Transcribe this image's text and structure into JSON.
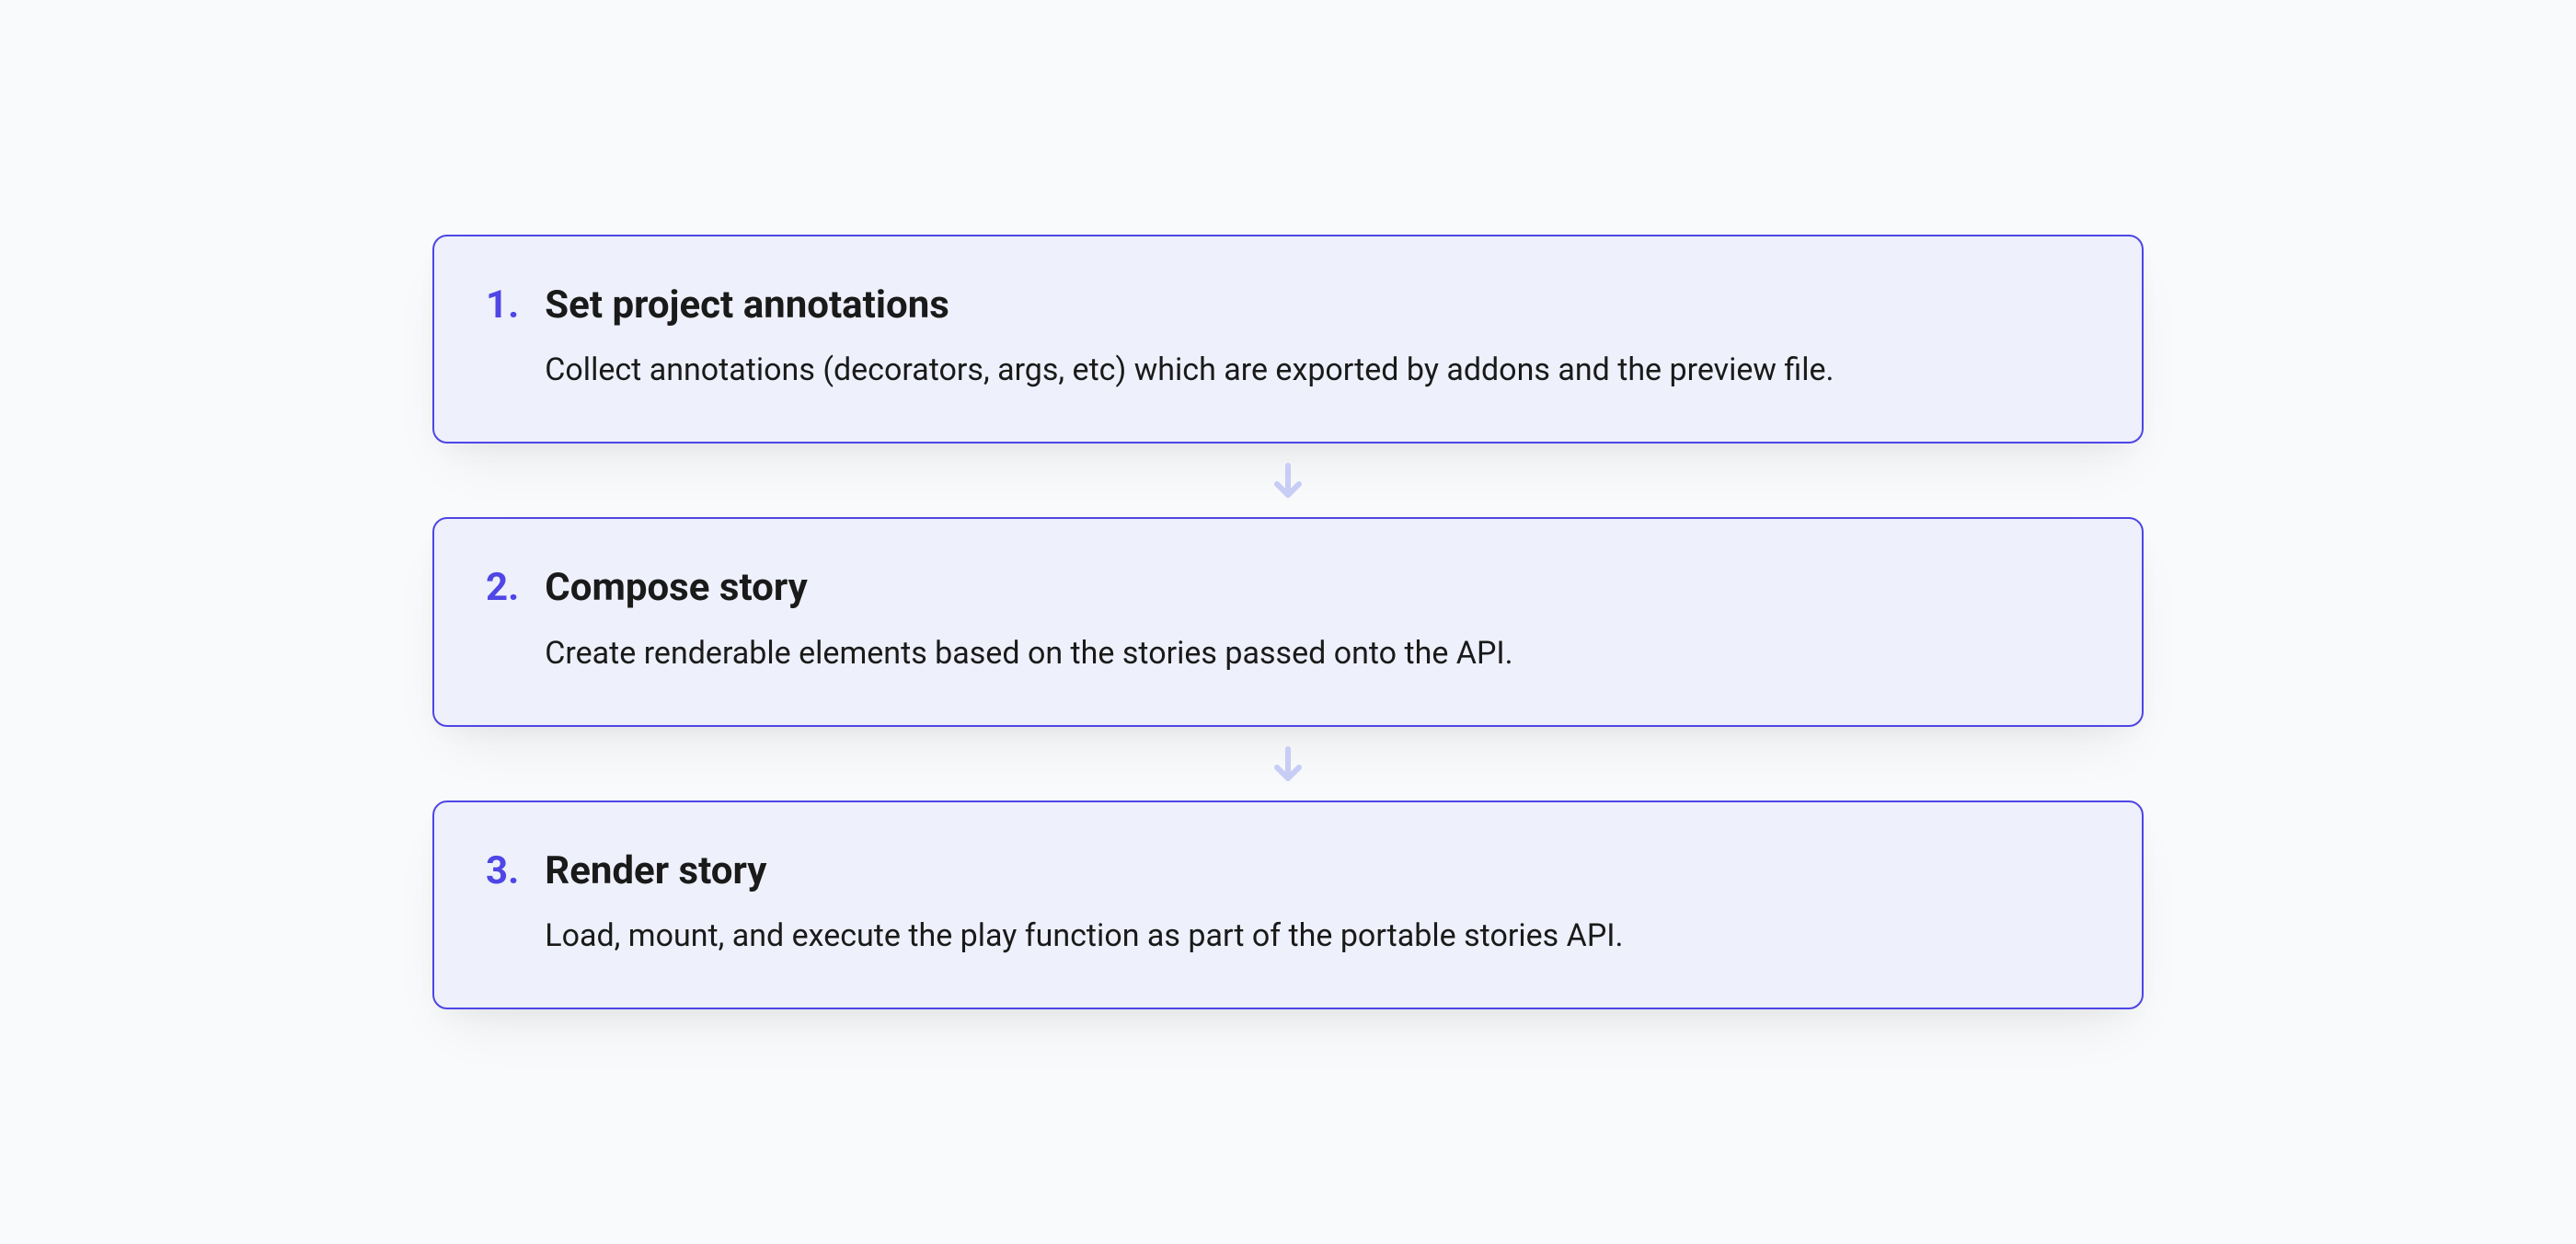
{
  "steps": [
    {
      "number": "1.",
      "title": "Set project annotations",
      "description": "Collect annotations (decorators, args, etc) which are exported by addons and the preview file."
    },
    {
      "number": "2.",
      "title": "Compose story",
      "description": "Create renderable elements based on the stories passed onto the API."
    },
    {
      "number": "3.",
      "title": "Render story",
      "description": "Load, mount, and execute the play function as part of the portable stories API."
    }
  ]
}
